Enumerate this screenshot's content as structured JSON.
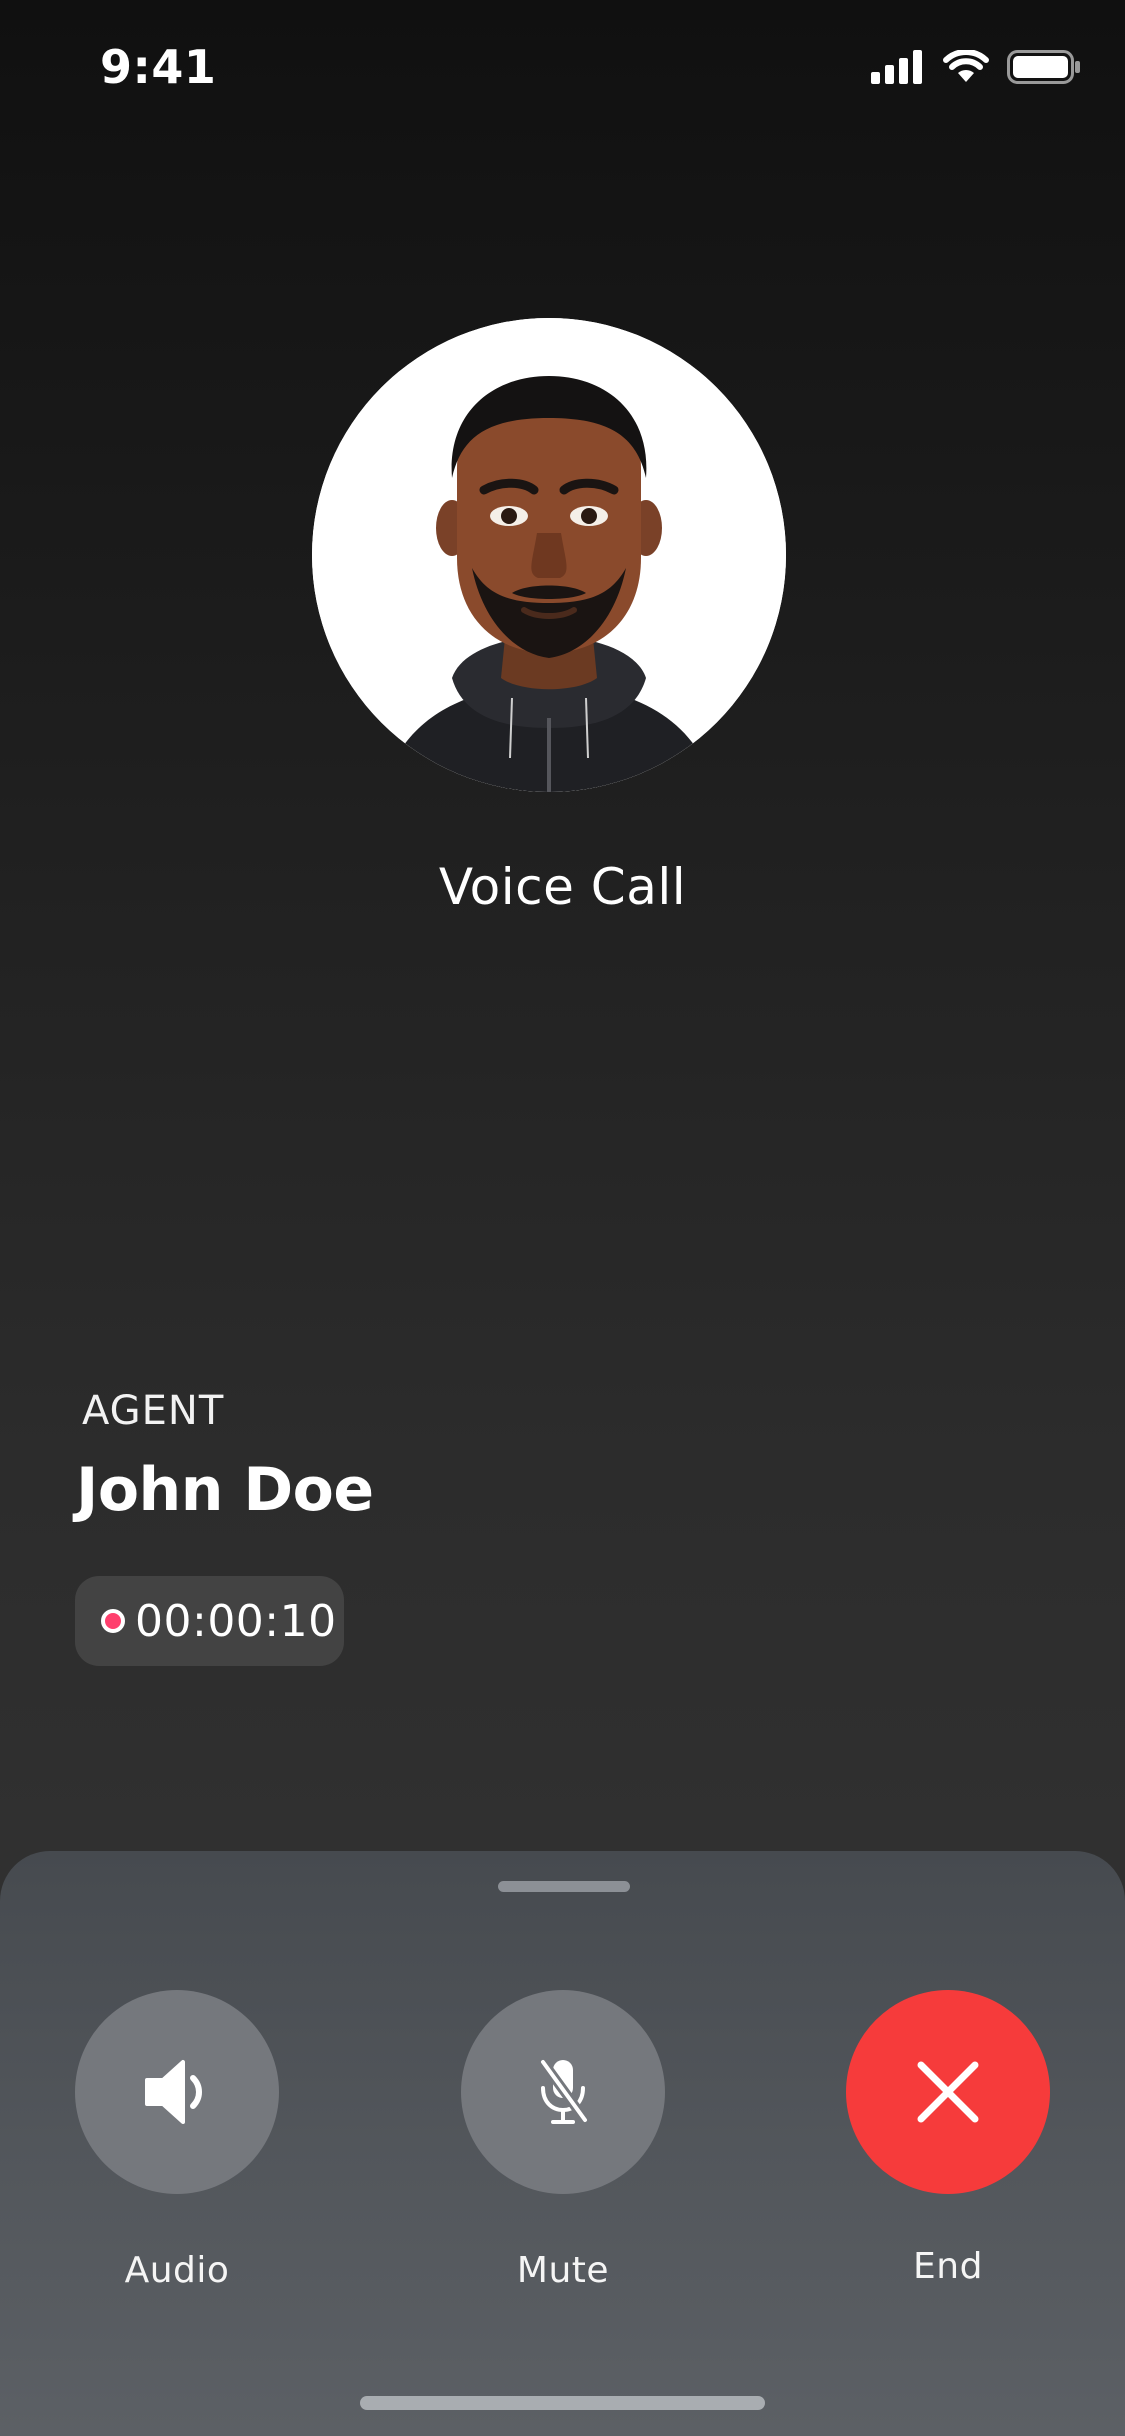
{
  "status_bar": {
    "time": "9:41",
    "icons": [
      "cellular-signal-icon",
      "wifi-icon",
      "battery-icon"
    ]
  },
  "call": {
    "title": "Voice Call",
    "agent_role": "AGENT",
    "agent_name": "John Doe",
    "duration": "00:00:10",
    "recording": true
  },
  "controls": {
    "audio": {
      "label": "Audio",
      "icon": "speaker-icon"
    },
    "mute": {
      "label": "Mute",
      "icon": "mic-off-icon"
    },
    "end": {
      "label": "End",
      "icon": "close-icon"
    }
  },
  "colors": {
    "end_button": "#f63b3b",
    "control_button": "#75787d",
    "recording_dot": "#ff3f6d"
  }
}
